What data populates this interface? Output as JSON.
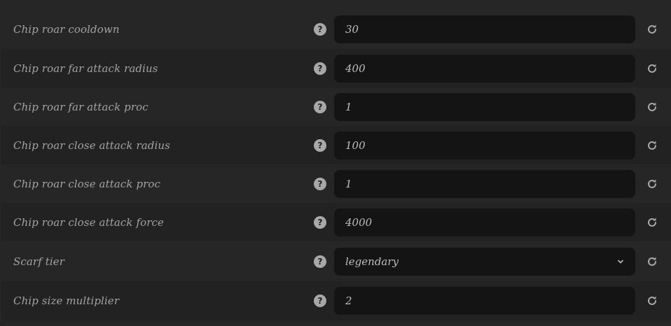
{
  "settings": [
    {
      "label": "Chip roar cooldown",
      "value": "30",
      "type": "text"
    },
    {
      "label": "Chip roar far attack radius",
      "value": "400",
      "type": "text"
    },
    {
      "label": "Chip roar far attack proc",
      "value": "1",
      "type": "text"
    },
    {
      "label": "Chip roar close attack radius",
      "value": "100",
      "type": "text"
    },
    {
      "label": "Chip roar close attack proc",
      "value": "1",
      "type": "text"
    },
    {
      "label": "Chip roar close attack force",
      "value": "4000",
      "type": "text"
    },
    {
      "label": "Scarf tier",
      "value": "legendary",
      "type": "select"
    },
    {
      "label": "Chip size multiplier",
      "value": "2",
      "type": "text"
    }
  ],
  "icons": {
    "help": "question-circle-icon",
    "reset": "reset-arrow-icon",
    "dropdown": "chevron-down-icon"
  },
  "colors": {
    "background": "#262626",
    "row_alt": "#222222",
    "field": "#141414",
    "label_text": "#a3a3a3",
    "value_text": "#bdbdbd",
    "icon": "#a8a8a8"
  }
}
